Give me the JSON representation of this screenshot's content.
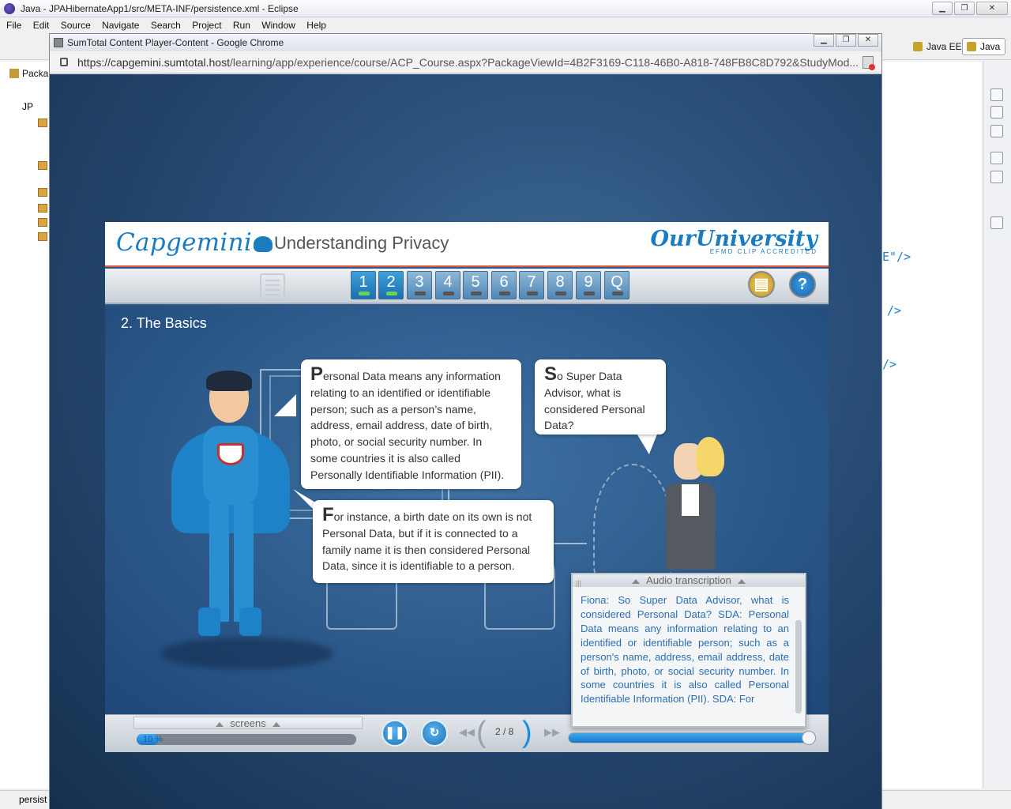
{
  "eclipse": {
    "title": "Java - JPAHibernateApp1/src/META-INF/persistence.xml - Eclipse",
    "menu": [
      "File",
      "Edit",
      "Source",
      "Navigate",
      "Search",
      "Project",
      "Run",
      "Window",
      "Help"
    ],
    "perspectives": [
      "Java EE",
      "Java"
    ],
    "left_tab": "Packa",
    "tree_label": "JP",
    "xml_fragments": [
      "E\"/>",
      "/>",
      "/>"
    ],
    "status_tab": "persist"
  },
  "chrome": {
    "title": "SumTotal Content Player-Content - Google Chrome",
    "url_host": "https://capgemini.sumtotal.host",
    "url_path": "/learning/app/experience/course/ACP_Course.aspx?PackageViewId=4B2F3169-C118-46B0-A818-748FB8C8D792&StudyMod..."
  },
  "course": {
    "brand": "Capgemini",
    "title": "Understanding Privacy",
    "university_logo": "OurUniversity",
    "university_sub": "EFMD CLIP ACCREDITED",
    "screen_tabs": [
      "1",
      "2",
      "3",
      "4",
      "5",
      "6",
      "7",
      "8",
      "9",
      "Q"
    ],
    "screens_completed": 2,
    "notes_icon": "notes-icon",
    "help_label": "?",
    "screen_heading": "2. The Basics",
    "bubble1_cap": "P",
    "bubble1_text": "ersonal Data means any information relating to an identified or identifiable person; such as a person’s name, address, email address, date of birth, photo, or social security number. In some countries it is also called Personally Identifiable Information (PII).",
    "bubble2_cap": "S",
    "bubble2_text": "o Super Data Advisor, what is considered Personal Data?",
    "bubble3_cap": "F",
    "bubble3_text": "or instance, a birth date on its own is not Personal Data, but if it is connected to a family name it is then considered Personal Data, since it is identifiable to a person.",
    "transcript_title": "Audio transcription",
    "transcript_text": "Fiona: So Super Data Advisor, what is considered Personal Data? SDA: Personal Data means any information relating to an identified or identifiable person; such as a person's name, address, email address, date of birth, photo, or social security number. In some countries it is also called Personal Identifiable Information (PII). SDA: For",
    "screens_label": "screens",
    "progress_label": "10 %",
    "progress_fraction": 0.1,
    "page_counter": "2 / 8",
    "audio_fraction": 1.0,
    "colors": {
      "accent_blue": "#1b7cbf",
      "header_rule": "#e0573f",
      "stage_bg": "#2b5889"
    }
  }
}
